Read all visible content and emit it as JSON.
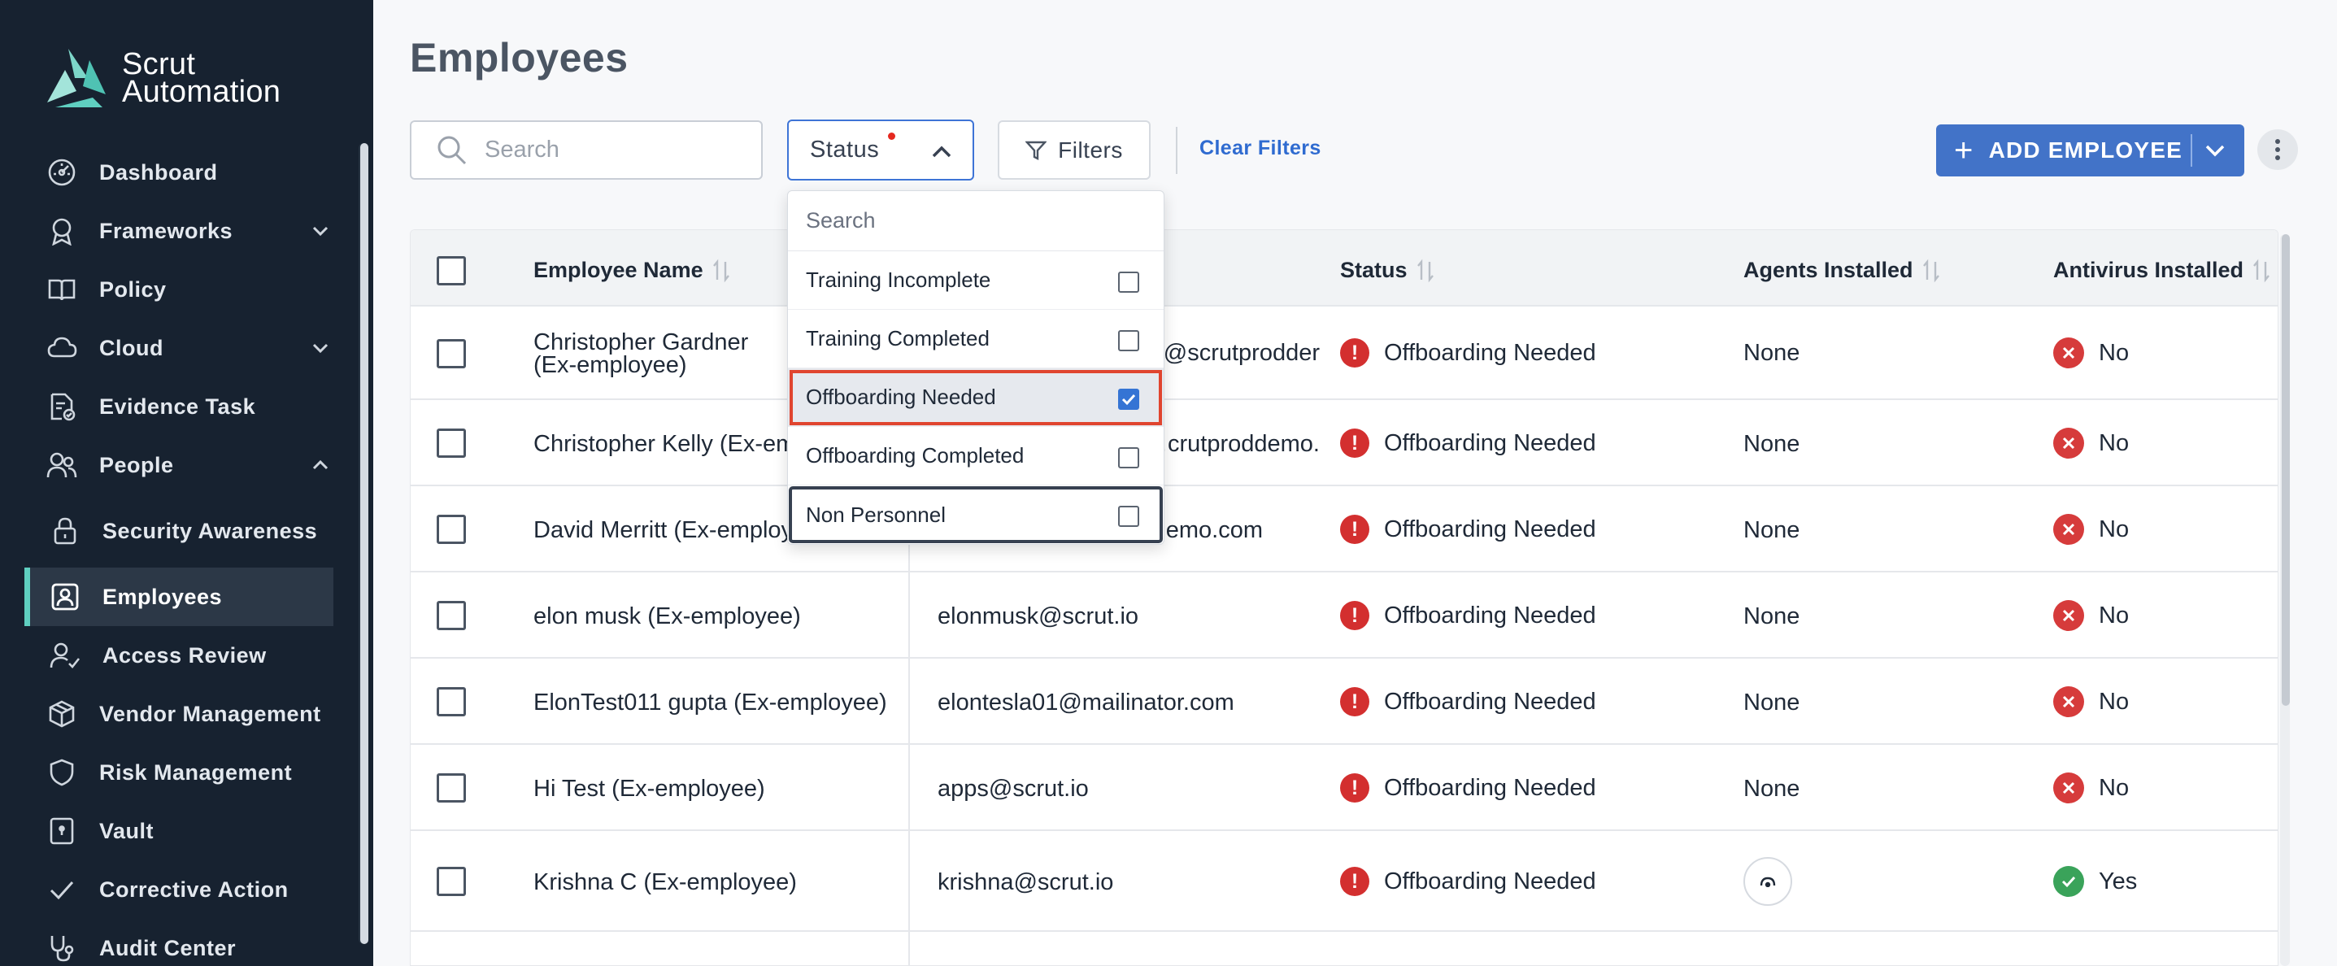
{
  "brand": {
    "line1": "Scrut",
    "line2": "Automation"
  },
  "sidebar": {
    "items": [
      {
        "label": "Dashboard",
        "icon": "dashboard-icon"
      },
      {
        "label": "Frameworks",
        "icon": "award-icon",
        "expand": "chevron-down"
      },
      {
        "label": "Policy",
        "icon": "book-icon"
      },
      {
        "label": "Cloud",
        "icon": "cloud-icon",
        "expand": "chevron-down"
      },
      {
        "label": "Evidence Task",
        "icon": "document-check-icon"
      },
      {
        "label": "People",
        "icon": "people-icon",
        "expand": "chevron-up"
      },
      {
        "label": "Security Awareness",
        "icon": "lock-icon"
      },
      {
        "label": "Employees",
        "icon": "employee-badge-icon",
        "active": true
      },
      {
        "label": "Access Review",
        "icon": "user-check-icon"
      },
      {
        "label": "Vendor Management",
        "icon": "cube-icon"
      },
      {
        "label": "Risk Management",
        "icon": "shield-icon"
      },
      {
        "label": "Vault",
        "icon": "vault-icon"
      },
      {
        "label": "Corrective Action",
        "icon": "check-icon"
      },
      {
        "label": "Audit Center",
        "icon": "stethoscope-icon"
      }
    ]
  },
  "page": {
    "title": "Employees"
  },
  "toolbar": {
    "search_placeholder": "Search",
    "status_label": "Status",
    "filters_label": "Filters",
    "clear_filters": "Clear Filters",
    "add_employee": "ADD EMPLOYEE"
  },
  "dropdown": {
    "search_placeholder": "Search",
    "options": [
      {
        "label": "Training Incomplete",
        "checked": false
      },
      {
        "label": "Training Completed",
        "checked": false
      },
      {
        "label": "Offboarding Needed",
        "checked": true
      },
      {
        "label": "Offboarding Completed",
        "checked": false
      },
      {
        "label": "Non Personnel",
        "checked": false
      }
    ]
  },
  "table": {
    "headers": {
      "name": "Employee Name",
      "status": "Status",
      "agents": "Agents Installed",
      "antivirus": "Antivirus Installed"
    },
    "rows": [
      {
        "name": "Christopher Gardner (Ex-employee)",
        "email": "…/@scrutprodder",
        "status": "Offboarding Needed",
        "agents": "None",
        "antivirus": "No"
      },
      {
        "name": "Christopher Kelly (Ex-emp",
        "email": "…crutproddemo.",
        "status": "Offboarding Needed",
        "agents": "None",
        "antivirus": "No"
      },
      {
        "name": "David Merritt (Ex-employe",
        "email": "…emo.com",
        "status": "Offboarding Needed",
        "agents": "None",
        "antivirus": "No"
      },
      {
        "name": "elon musk (Ex-employee)",
        "email": "elonmusk@scrut.io",
        "status": "Offboarding Needed",
        "agents": "None",
        "antivirus": "No"
      },
      {
        "name": "ElonTest011 gupta (Ex-employee)",
        "email": "elontesla01@mailinator.com",
        "status": "Offboarding Needed",
        "agents": "None",
        "antivirus": "No"
      },
      {
        "name": "Hi Test (Ex-employee)",
        "email": "apps@scrut.io",
        "status": "Offboarding Needed",
        "agents": "None",
        "antivirus": "No"
      },
      {
        "name": "Krishna C (Ex-employee)",
        "email": "krishna@scrut.io",
        "status": "Offboarding Needed",
        "agents": "",
        "antivirus": "Yes"
      }
    ]
  },
  "colors": {
    "sidebar_bg": "#172230",
    "accent": "#4273c8",
    "error": "#d32f2f",
    "success": "#3aa35a",
    "highlight": "#e0452f"
  }
}
